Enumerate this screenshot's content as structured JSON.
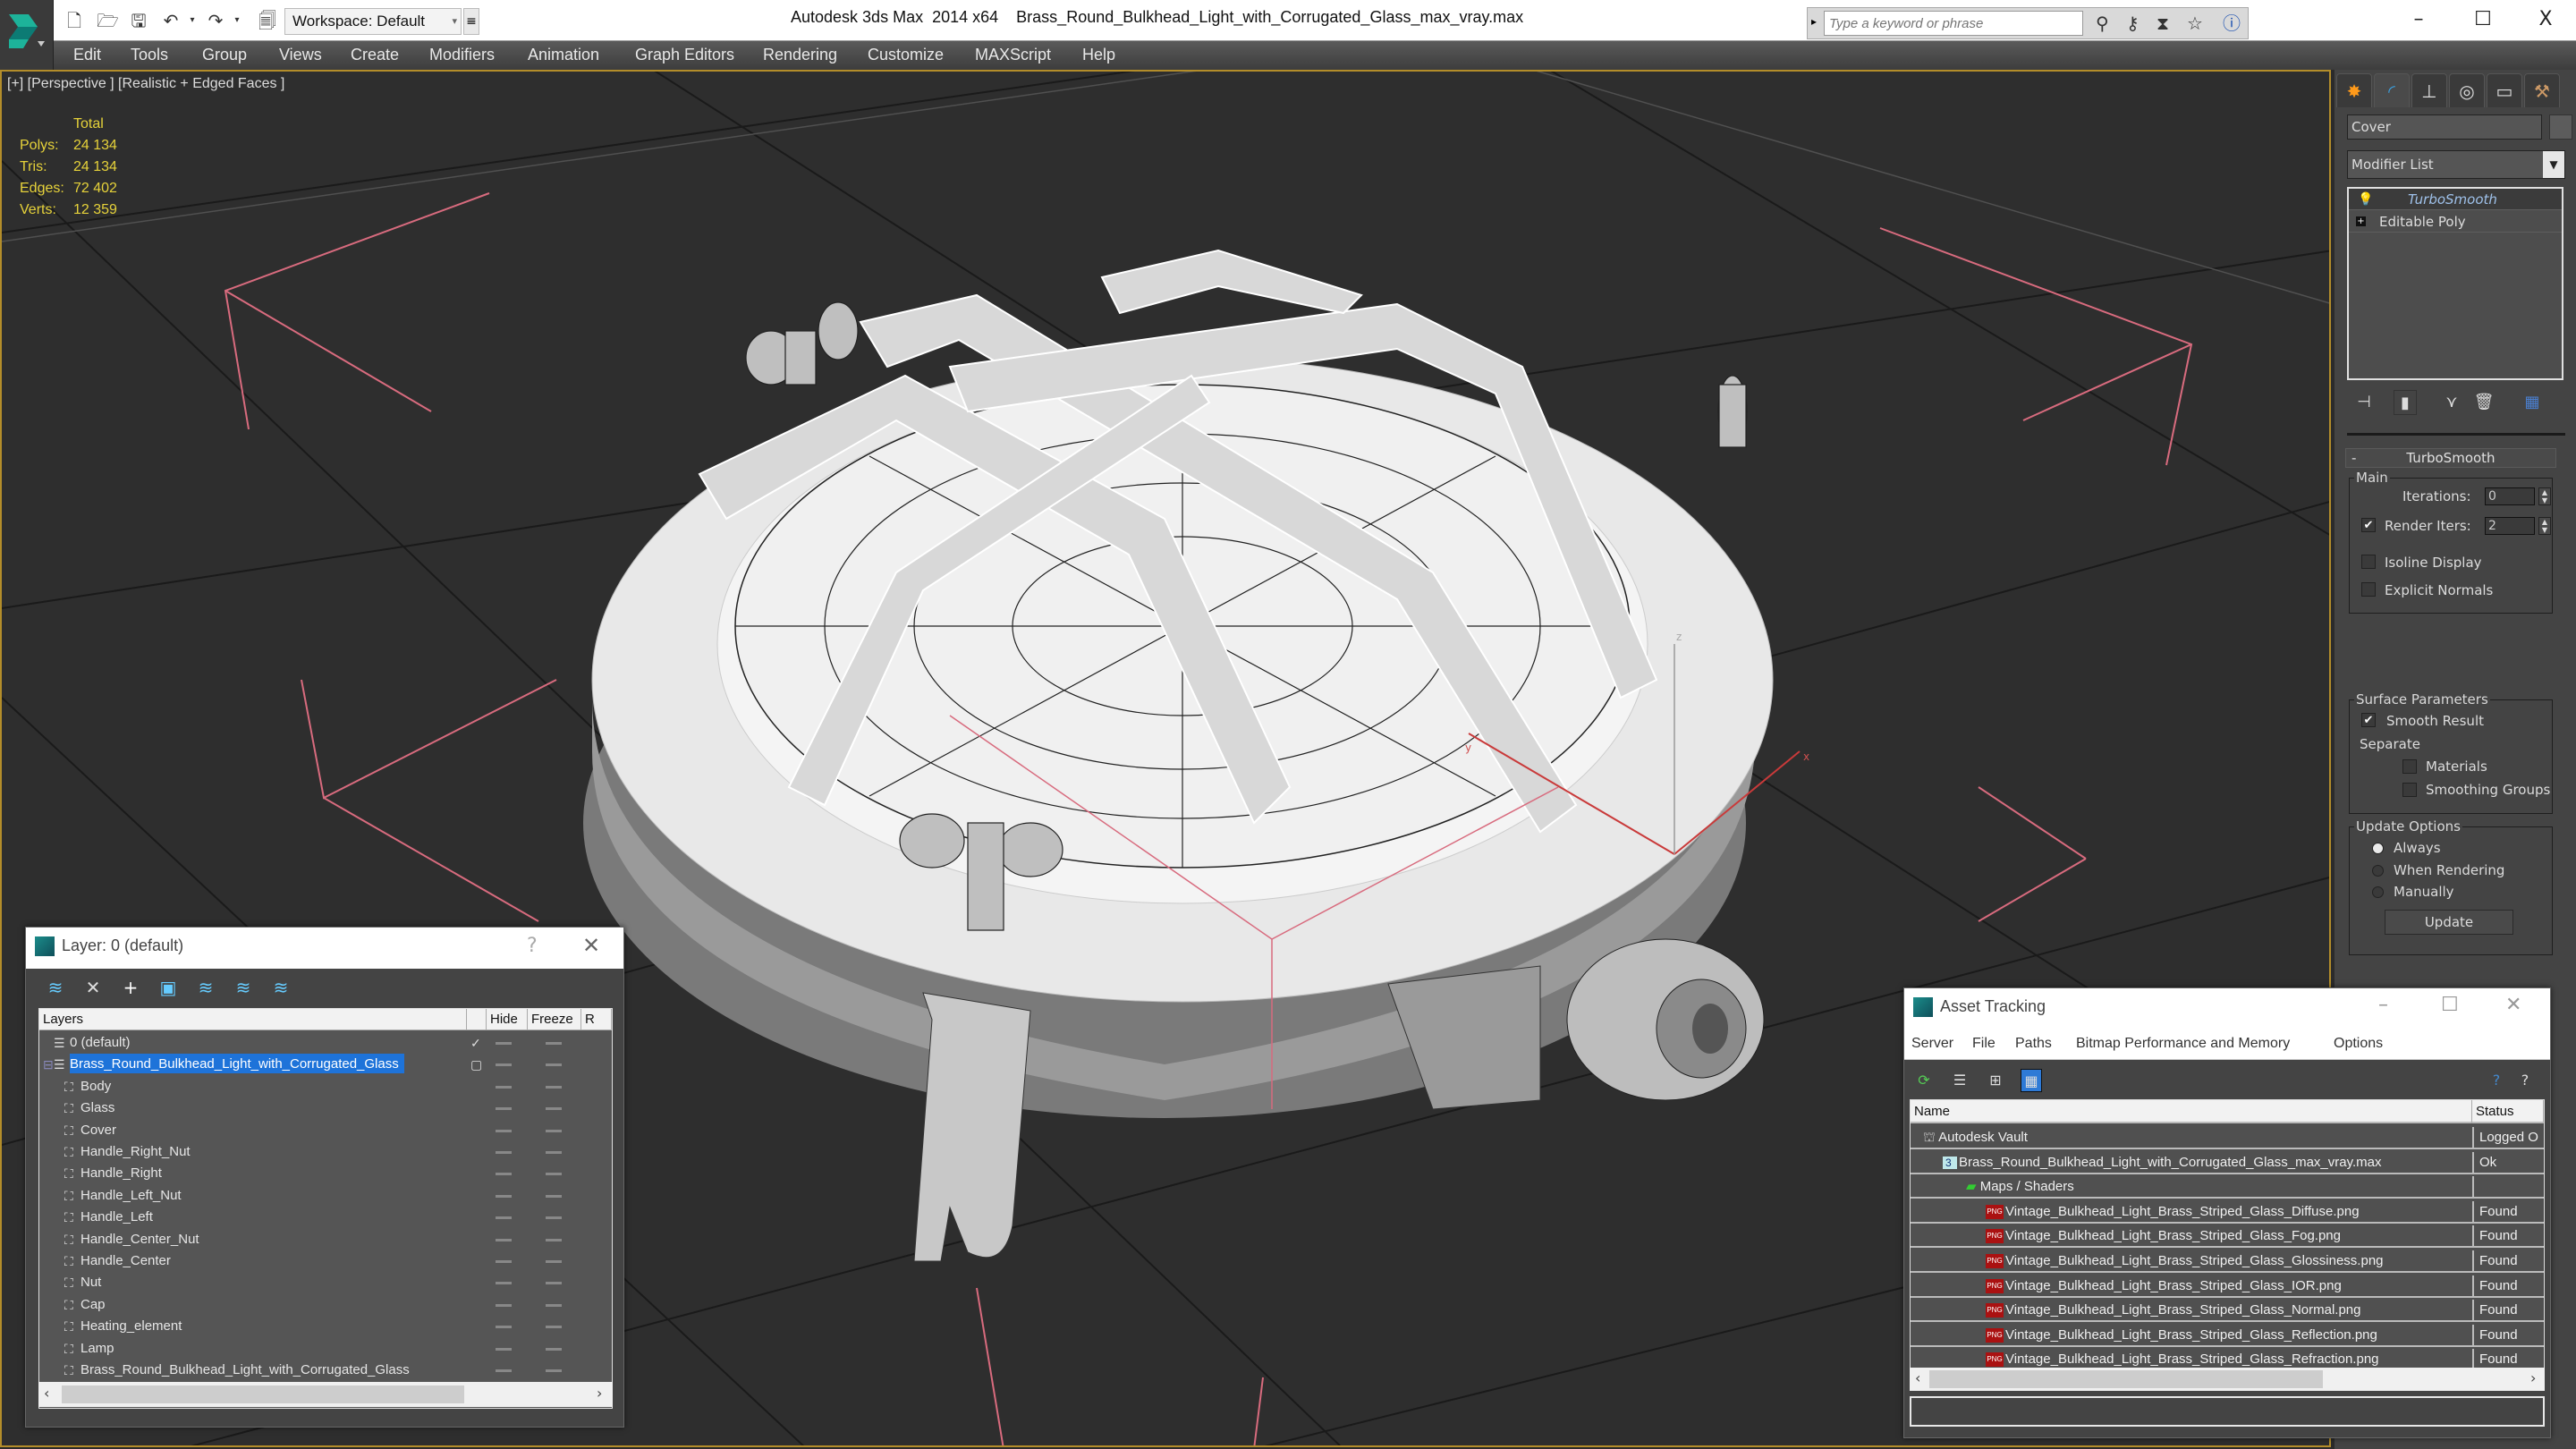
{
  "title_bar": {
    "app_title": "Autodesk 3ds Max  2014 x64",
    "file_name": "Brass_Round_Bulkhead_Light_with_Corrugated_Glass_max_vray.max",
    "workspace": "Workspace: Default",
    "search_placeholder": "Type a keyword or phrase",
    "quick_access_icons": [
      "new-file-icon",
      "open-file-icon",
      "save-icon",
      "undo-icon",
      "redo-icon",
      "project-folder-icon"
    ],
    "search_tools": [
      "binoculars-icon",
      "key-icon",
      "communication-center-icon",
      "favorites-star-icon",
      "help-icon"
    ],
    "window_controls": {
      "minimize": "–",
      "maximize": "☐",
      "close": "X"
    }
  },
  "menu": {
    "items": [
      "Edit",
      "Tools",
      "Group",
      "Views",
      "Create",
      "Modifiers",
      "Animation",
      "Graph Editors",
      "Rendering",
      "Customize",
      "MAXScript",
      "Help"
    ]
  },
  "viewport": {
    "label": "[+] [Perspective ] [Realistic + Edged Faces ]",
    "stats": {
      "header": "Total",
      "rows": [
        {
          "label": "Polys:",
          "value": "24 134"
        },
        {
          "label": "Tris:",
          "value": "24 134"
        },
        {
          "label": "Edges:",
          "value": "72 402"
        },
        {
          "label": "Verts:",
          "value": "12 359"
        }
      ]
    },
    "stats_color": "#e6d23a",
    "border_color": "#b38d2a",
    "gizmo_labels": {
      "x": "x",
      "y": "y",
      "z": "z"
    }
  },
  "command_panel": {
    "tabs": [
      "create-tab",
      "modify-tab",
      "hierarchy-tab",
      "motion-tab",
      "display-tab",
      "utilities-tab"
    ],
    "object_name": "Cover",
    "modifier_list_label": "Modifier List",
    "stack": [
      {
        "label": "TurboSmooth",
        "selected": true
      },
      {
        "label": "Editable Poly",
        "selected": false
      }
    ],
    "rollout": {
      "title": "TurboSmooth",
      "collapse_symbol": "-",
      "main": {
        "title": "Main",
        "iterations_label": "Iterations:",
        "iterations_value": "0",
        "render_iters_label": "Render Iters:",
        "render_iters_value": "2",
        "render_iters_checked": true,
        "isoline_label": "Isoline Display",
        "isoline_checked": false,
        "explicit_normals_label": "Explicit Normals",
        "explicit_normals_checked": false
      },
      "surface": {
        "title": "Surface Parameters",
        "smooth_result_label": "Smooth Result",
        "smooth_result_checked": true,
        "separate_label": "Separate",
        "materials_label": "Materials",
        "materials_checked": false,
        "smoothing_groups_label": "Smoothing Groups",
        "smoothing_groups_checked": false
      },
      "update": {
        "title": "Update Options",
        "options": [
          "Always",
          "When Rendering",
          "Manually"
        ],
        "selected": "Always",
        "button": "Update"
      }
    }
  },
  "layer_dialog": {
    "title": "Layer: 0 (default)",
    "help": "?",
    "close": "✕",
    "columns": [
      "Layers",
      "",
      "Hide",
      "Freeze",
      "R"
    ],
    "rows": [
      {
        "name": "0 (default)",
        "type": "layer",
        "indent": 0,
        "current": true,
        "selected": false
      },
      {
        "name": "Brass_Round_Bulkhead_Light_with_Corrugated_Glass",
        "type": "layer",
        "indent": 0,
        "current": false,
        "selected": true,
        "expanded": true
      },
      {
        "name": "Body",
        "type": "object",
        "indent": 1
      },
      {
        "name": "Glass",
        "type": "object",
        "indent": 1
      },
      {
        "name": "Cover",
        "type": "object",
        "indent": 1
      },
      {
        "name": "Handle_Right_Nut",
        "type": "object",
        "indent": 1
      },
      {
        "name": "Handle_Right",
        "type": "object",
        "indent": 1
      },
      {
        "name": "Handle_Left_Nut",
        "type": "object",
        "indent": 1
      },
      {
        "name": "Handle_Left",
        "type": "object",
        "indent": 1
      },
      {
        "name": "Handle_Center_Nut",
        "type": "object",
        "indent": 1
      },
      {
        "name": "Handle_Center",
        "type": "object",
        "indent": 1
      },
      {
        "name": "Nut",
        "type": "object",
        "indent": 1
      },
      {
        "name": "Cap",
        "type": "object",
        "indent": 1
      },
      {
        "name": "Heating_element",
        "type": "object",
        "indent": 1
      },
      {
        "name": "Lamp",
        "type": "object",
        "indent": 1
      },
      {
        "name": "Brass_Round_Bulkhead_Light_with_Corrugated_Glass",
        "type": "object",
        "indent": 1
      }
    ],
    "selection_color": "#1e73d9"
  },
  "asset_tracking": {
    "title": "Asset Tracking",
    "menu": [
      "Server",
      "File",
      "Paths",
      "Bitmap Performance and Memory",
      "Options"
    ],
    "columns": [
      "Name",
      "Status"
    ],
    "rows": [
      {
        "name": "Autodesk Vault",
        "status": "Logged O",
        "indent": 0,
        "icon": "vault-icon"
      },
      {
        "name": "Brass_Round_Bulkhead_Light_with_Corrugated_Glass_max_vray.max",
        "status": "Ok",
        "indent": 1,
        "icon": "max-file-icon"
      },
      {
        "name": "Maps / Shaders",
        "status": "",
        "indent": 2,
        "icon": "maps-icon"
      },
      {
        "name": "Vintage_Bulkhead_Light_Brass_Striped_Glass_Diffuse.png",
        "status": "Found",
        "indent": 3,
        "icon": "png-icon"
      },
      {
        "name": "Vintage_Bulkhead_Light_Brass_Striped_Glass_Fog.png",
        "status": "Found",
        "indent": 3,
        "icon": "png-icon"
      },
      {
        "name": "Vintage_Bulkhead_Light_Brass_Striped_Glass_Glossiness.png",
        "status": "Found",
        "indent": 3,
        "icon": "png-icon"
      },
      {
        "name": "Vintage_Bulkhead_Light_Brass_Striped_Glass_IOR.png",
        "status": "Found",
        "indent": 3,
        "icon": "png-icon"
      },
      {
        "name": "Vintage_Bulkhead_Light_Brass_Striped_Glass_Normal.png",
        "status": "Found",
        "indent": 3,
        "icon": "png-icon"
      },
      {
        "name": "Vintage_Bulkhead_Light_Brass_Striped_Glass_Reflection.png",
        "status": "Found",
        "indent": 3,
        "icon": "png-icon"
      },
      {
        "name": "Vintage_Bulkhead_Light_Brass_Striped_Glass_Refraction.png",
        "status": "Found",
        "indent": 3,
        "icon": "png-icon"
      }
    ],
    "png_badge": "PNG"
  }
}
